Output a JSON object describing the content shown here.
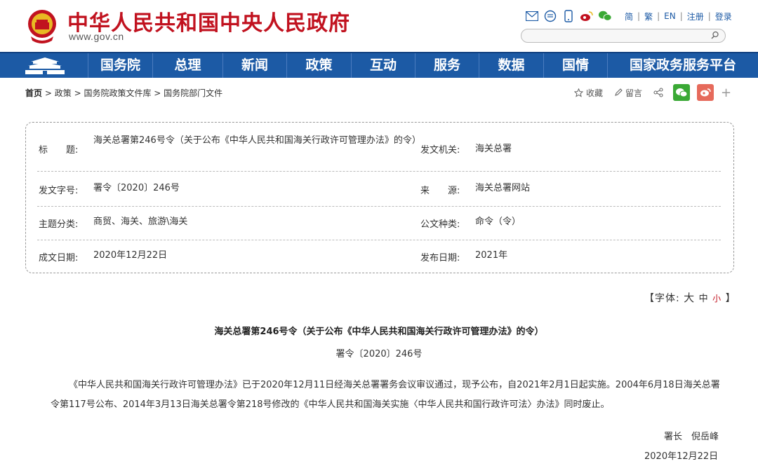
{
  "header": {
    "site_title": "中华人民共和国中央人民政府",
    "site_url": "www.gov.cn",
    "links": [
      "简",
      "繁",
      "EN",
      "注册",
      "登录"
    ]
  },
  "nav": {
    "items": [
      "国务院",
      "总理",
      "新闻",
      "政策",
      "互动",
      "服务",
      "数据",
      "国情",
      "国家政务服务平台"
    ]
  },
  "breadcrumb": {
    "home": "首页",
    "path": [
      "政策",
      "国务院政策文件库",
      "国务院部门文件"
    ]
  },
  "tools": {
    "favorite": "收藏",
    "comment": "留言"
  },
  "info": {
    "title_label": "标　　题:",
    "title_value": "海关总署第246号令（关于公布《中华人民共和国海关行政许可管理办法》的令）",
    "issuer_label": "发文机关:",
    "issuer_value": "海关总署",
    "docno_label": "发文字号:",
    "docno_value": "署令〔2020〕246号",
    "source_label": "来　　源:",
    "source_value": "海关总署网站",
    "topic_label": "主题分类:",
    "topic_value": "商贸、海关、旅游\\海关",
    "type_label": "公文种类:",
    "type_value": "命令（令）",
    "written_label": "成文日期:",
    "written_value": "2020年12月22日",
    "published_label": "发布日期:",
    "published_value": "2021年"
  },
  "fontsize": {
    "prefix": "【字体:",
    "large": "大",
    "medium": "中",
    "small": "小",
    "suffix": "】"
  },
  "article": {
    "title": "海关总署第246号令（关于公布《中华人民共和国海关行政许可管理办法》的令）",
    "doc_no": "署令〔2020〕246号",
    "body": "《中华人民共和国海关行政许可管理办法》已于2020年12月11日经海关总署署务会议审议通过，现予公布，自2021年2月1日起实施。2004年6月18日海关总署令第117号公布、2014年3月13日海关总署令第218号修改的《中华人民共和国海关实施〈中华人民共和国行政许可法〉办法》同时废止。",
    "signer": "署长　倪岳峰",
    "date": "2020年12月22日"
  },
  "colors": {
    "brand_red": "#c1121f",
    "nav_blue": "#1c5aa5"
  }
}
